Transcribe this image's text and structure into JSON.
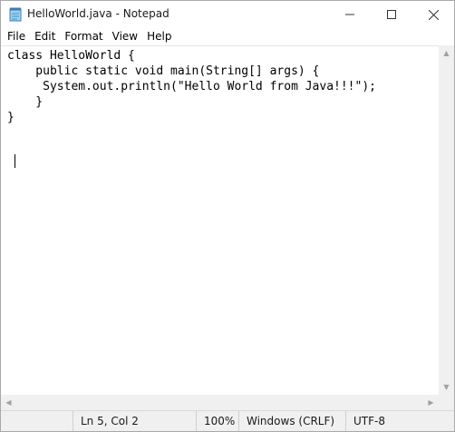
{
  "window": {
    "title": "HelloWorld.java - Notepad"
  },
  "menu": {
    "items": [
      "File",
      "Edit",
      "Format",
      "View",
      "Help"
    ]
  },
  "editor": {
    "lines": [
      "class HelloWorld {",
      "    public static void main(String[] args) {",
      "     System.out.println(\"Hello World from Java!!!\");",
      "    }",
      "}"
    ]
  },
  "status": {
    "position": "Ln 5, Col 2",
    "zoom": "100%",
    "line_ending": "Windows (CRLF)",
    "encoding": "UTF-8"
  },
  "icons": {
    "app": "notepad-icon",
    "minimize": "minimize-icon",
    "maximize": "maximize-icon",
    "close": "close-icon"
  },
  "colors": {
    "chrome": "#f0f0f0",
    "text": "#000000"
  }
}
